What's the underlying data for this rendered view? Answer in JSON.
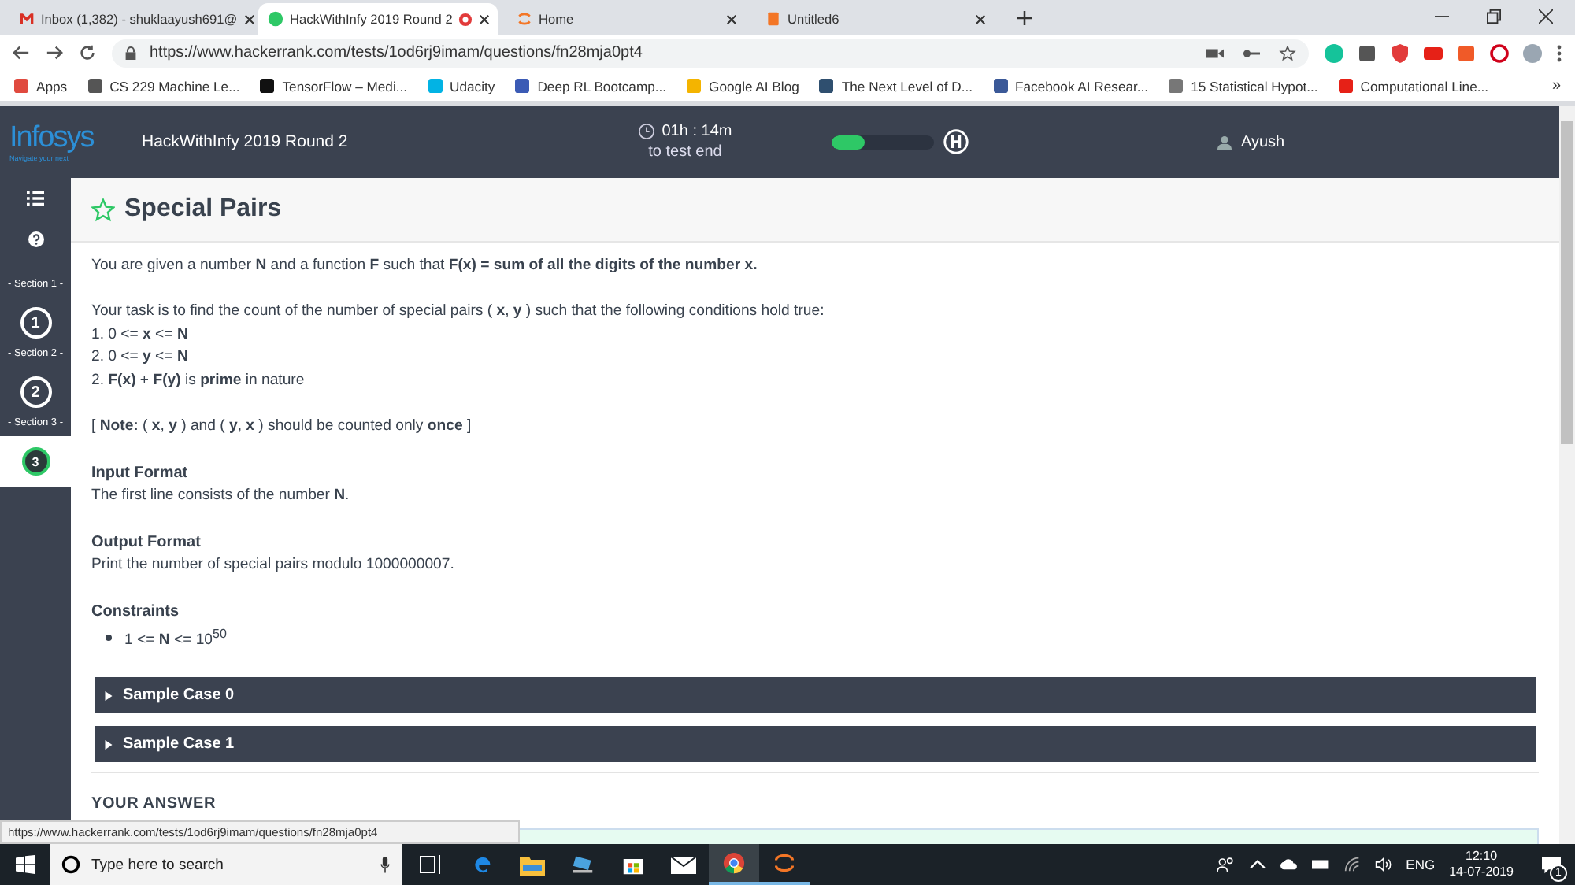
{
  "browser": {
    "tabs": [
      {
        "title": "Inbox (1,382) - shuklaayush691@",
        "kind": "mail",
        "selected": false
      },
      {
        "title": "HackWithInfy 2019 Round 2",
        "kind": "hackerrank",
        "selected": true,
        "recording": true
      },
      {
        "title": "Home",
        "kind": "jupyter",
        "selected": false
      },
      {
        "title": "Untitled6",
        "kind": "notebook",
        "selected": false
      }
    ],
    "url": "https://www.hackerrank.com/tests/1od6rj9imam/questions/fn28mja0pt4",
    "bookmarks": [
      {
        "label": "Apps",
        "color": "#e04a3f"
      },
      {
        "label": "CS 229 Machine Le...",
        "color": "#555555"
      },
      {
        "label": "TensorFlow – Medi...",
        "color": "#111111"
      },
      {
        "label": "Udacity",
        "color": "#02b3e4"
      },
      {
        "label": "Deep RL Bootcamp...",
        "color": "#3b5bb5"
      },
      {
        "label": "Google AI Blog",
        "color": "#f4b400"
      },
      {
        "label": "The Next Level of D...",
        "color": "#2f4f6f"
      },
      {
        "label": "Facebook AI Resear...",
        "color": "#3b5998"
      },
      {
        "label": "15 Statistical Hypot...",
        "color": "#777777"
      },
      {
        "label": "Computational Line...",
        "color": "#e62117"
      }
    ],
    "more_bookmarks": "»"
  },
  "header": {
    "logo": "Infosys",
    "tagline": "Navigate your next",
    "title": "HackWithInfy 2019 Round 2",
    "timer": "01h : 14m",
    "timer_caption": "to test end",
    "progress": {
      "level": 0.33
    },
    "user": "Ayush"
  },
  "sidebar": {
    "sections": [
      {
        "label": "- Section 1 -",
        "number": "1",
        "selected": false
      },
      {
        "label": "- Section 2 -",
        "number": "2",
        "selected": false
      },
      {
        "label": "- Section 3 -",
        "number": "3",
        "selected": true
      }
    ]
  },
  "problem": {
    "title": "Special Pairs",
    "starred": false,
    "blocks": [
      {
        "kind": "para",
        "lines": [
          "You are given a number **N** and a function **F** such that **F(x) = sum of all the digits of the number x.**"
        ]
      },
      {
        "kind": "para",
        "lines": [
          "Your task is to find the count of the number of special pairs ( **x**,  **y** ) such that the following conditions hold true:",
          "1. 0 <= **x** <= **N**",
          "2. 0 <= **y** <= **N**",
          "2. **F(x)** + **F(y)** is **prime** in nature"
        ]
      },
      {
        "kind": "para",
        "lines": [
          "[ **Note:** ( **x**, **y** ) and ( **y**, **x** ) should be counted only **once** ]"
        ]
      },
      {
        "kind": "section",
        "heading": "Input Format",
        "lines": [
          "The first line consists of the number **N**."
        ]
      },
      {
        "kind": "section",
        "heading": "Output Format",
        "lines": [
          "Print the number of special pairs modulo 1000000007."
        ]
      },
      {
        "kind": "list",
        "heading": "Constraints",
        "lines": [
          "1 <= **N** <= 10$^{50}$"
        ]
      }
    ],
    "samples": [
      {
        "title": "Sample Case 0",
        "expanded": false
      },
      {
        "title": "Sample Case 1",
        "expanded": false
      }
    ],
    "answer_heading": "YOUR ANSWER"
  },
  "status_url": "https://www.hackerrank.com/tests/1od6rj9imam/questions/fn28mja0pt4",
  "taskbar": {
    "search_placeholder": "Type here to search",
    "language": "ENG",
    "time": "12:10",
    "date": "14-07-2019",
    "notifications": "1"
  }
}
